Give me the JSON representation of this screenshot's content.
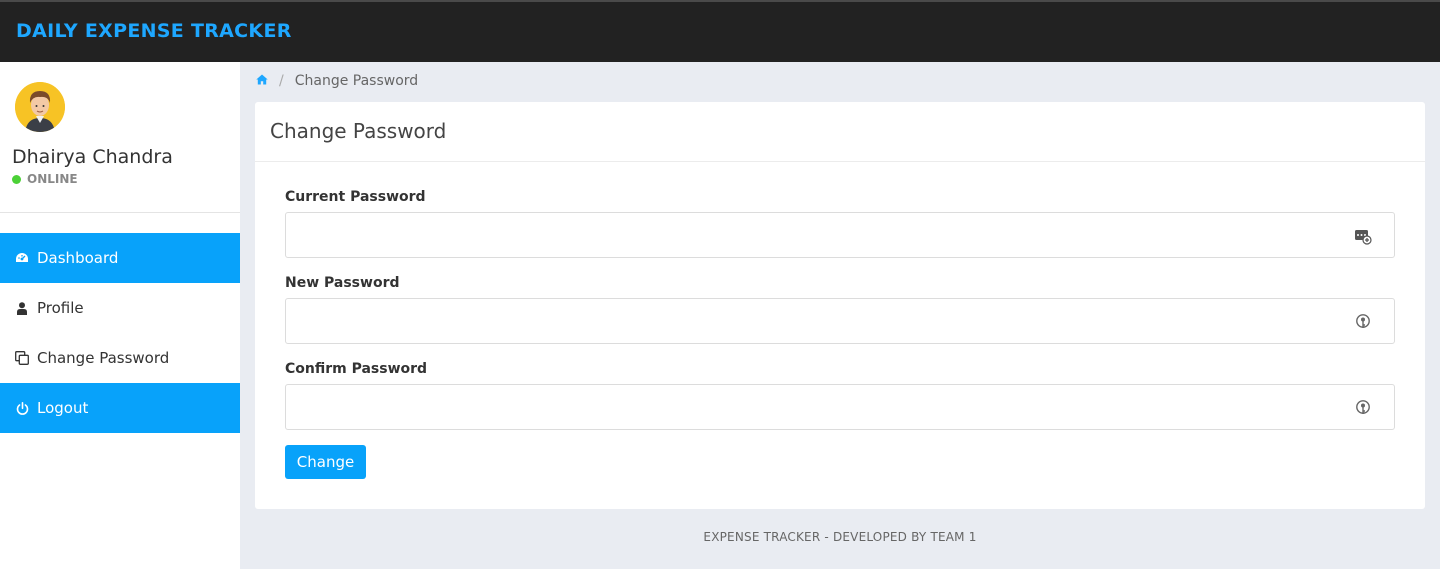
{
  "app": {
    "title": "DAILY EXPENSE TRACKER"
  },
  "user": {
    "name": "Dhairya Chandra",
    "status": "ONLINE"
  },
  "sidebar": {
    "items": [
      {
        "label": "Dashboard",
        "icon": "dashboard-icon",
        "active": true
      },
      {
        "label": "Profile",
        "icon": "user-icon",
        "active": false
      },
      {
        "label": "Change Password",
        "icon": "copy-icon",
        "active": false
      },
      {
        "label": "Logout",
        "icon": "power-icon",
        "active": true
      }
    ]
  },
  "breadcrumb": {
    "home_icon": "home-icon",
    "current": "Change Password"
  },
  "card": {
    "title": "Change Password",
    "fields": [
      {
        "label": "Current Password",
        "value": "",
        "icon": "password-manager-icon"
      },
      {
        "label": "New Password",
        "value": "",
        "icon": "key-icon"
      },
      {
        "label": "Confirm Password",
        "value": "",
        "icon": "key-icon"
      }
    ],
    "submit_label": "Change"
  },
  "footer": {
    "text": "EXPENSE TRACKER - DEVELOPED BY TEAM 1"
  },
  "colors": {
    "accent": "#08a2fa",
    "topbar": "#222222",
    "brand": "#1ea7ff",
    "online": "#4cd137"
  }
}
